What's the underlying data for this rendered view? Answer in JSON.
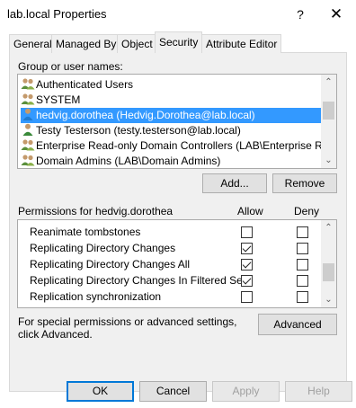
{
  "window": {
    "title": "lab.local Properties",
    "help_label": "?",
    "close_label": "✕"
  },
  "tabs": [
    "General",
    "Managed By",
    "Object",
    "Security",
    "Attribute Editor"
  ],
  "active_tab": "Security",
  "security": {
    "group_label": "Group or user names:",
    "users": [
      {
        "name": "Authenticated Users",
        "icon": "group-icon",
        "selected": false
      },
      {
        "name": "SYSTEM",
        "icon": "group-icon",
        "selected": false
      },
      {
        "name": "hedvig.dorothea (Hedvig.Dorothea@lab.local)",
        "icon": "user-icon",
        "selected": true
      },
      {
        "name": "Testy Testerson (testy.testerson@lab.local)",
        "icon": "user-icon",
        "selected": false
      },
      {
        "name": "Enterprise Read-only Domain Controllers (LAB\\Enterprise Read-...",
        "icon": "group-icon",
        "selected": false
      },
      {
        "name": "Domain Admins (LAB\\Domain Admins)",
        "icon": "group-icon",
        "selected": false
      }
    ],
    "add_label": "Add...",
    "remove_label": "Remove",
    "permissions_for_label": "Permissions for hedvig.dorothea",
    "allow_header": "Allow",
    "deny_header": "Deny",
    "permissions": [
      {
        "name": "Reanimate tombstones",
        "allow": false,
        "deny": false
      },
      {
        "name": "Replicating Directory Changes",
        "allow": true,
        "deny": false
      },
      {
        "name": "Replicating Directory Changes All",
        "allow": true,
        "deny": false
      },
      {
        "name": "Replicating Directory Changes In Filtered Set",
        "allow": true,
        "deny": false
      },
      {
        "name": "Replication synchronization",
        "allow": false,
        "deny": false
      }
    ],
    "advanced_text": "For special permissions or advanced settings, click Advanced.",
    "advanced_label": "Advanced"
  },
  "footer": {
    "ok_label": "OK",
    "cancel_label": "Cancel",
    "apply_label": "Apply",
    "help_label": "Help"
  },
  "colors": {
    "selection": "#3399ff",
    "default_button_border": "#0078d7"
  }
}
